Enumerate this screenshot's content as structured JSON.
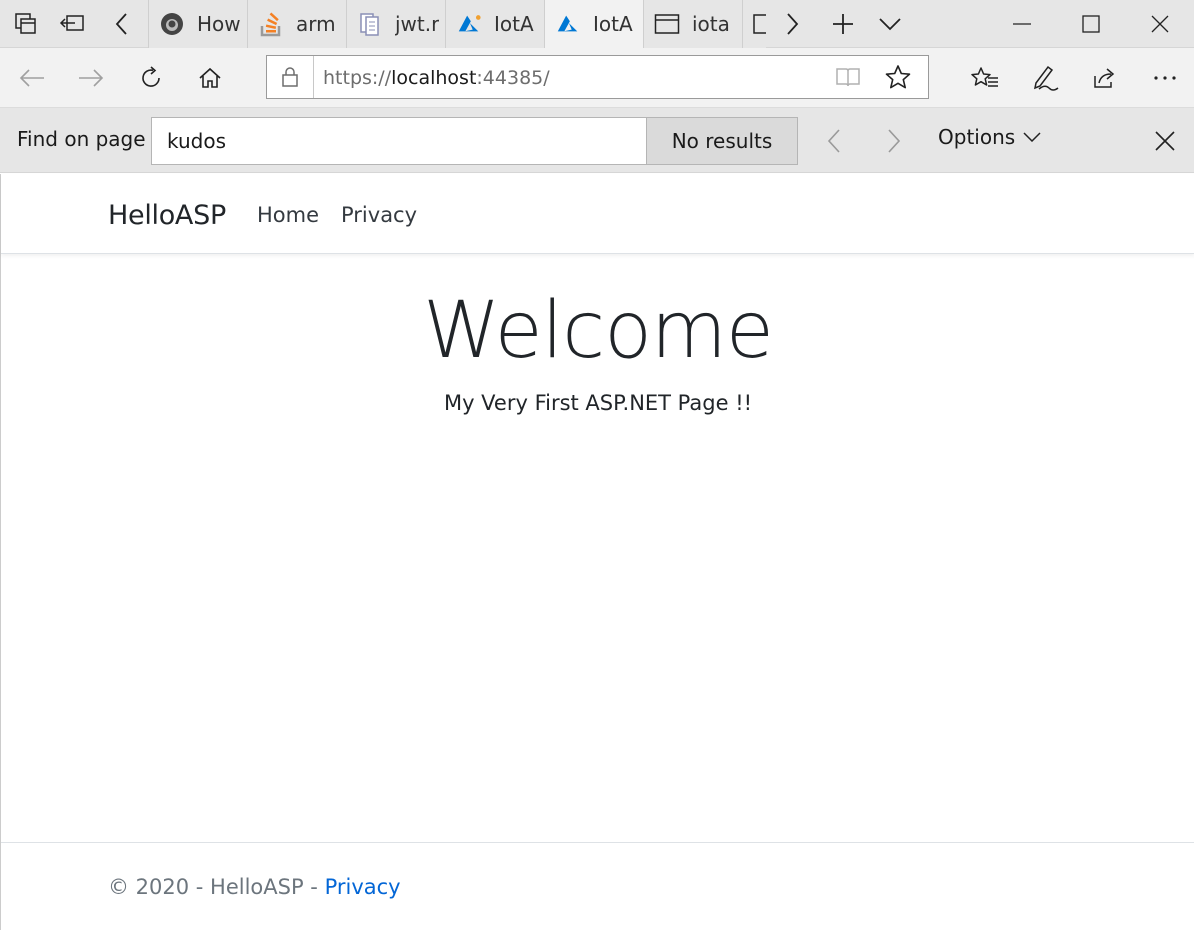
{
  "browser": {
    "tabs": [
      {
        "label": "How",
        "icon": "github-icon",
        "active": false
      },
      {
        "label": "arm",
        "icon": "stackoverflow-icon",
        "active": false
      },
      {
        "label": "jwt.r",
        "icon": "document-icon",
        "active": false
      },
      {
        "label": "IotA",
        "icon": "azure-icon",
        "active": false
      },
      {
        "label": "IotA",
        "icon": "azure-icon",
        "active": true
      },
      {
        "label": "iota",
        "icon": "window-icon",
        "active": false
      }
    ],
    "url": {
      "scheme": "https://",
      "host": "localhost",
      "rest": ":44385/"
    },
    "find": {
      "label": "Find on page",
      "query": "kudos",
      "results": "No results",
      "options_label": "Options"
    }
  },
  "site": {
    "brand": "HelloASP",
    "nav": [
      {
        "label": "Home"
      },
      {
        "label": "Privacy"
      }
    ],
    "heading": "Welcome",
    "subtitle": "My Very First ASP.NET Page !!",
    "footer": {
      "text": "© 2020 - HelloASP - ",
      "link": "Privacy"
    }
  },
  "colors": {
    "link": "#0366d6",
    "azure": "#0078d4",
    "stackoverflow": "#f48024"
  }
}
